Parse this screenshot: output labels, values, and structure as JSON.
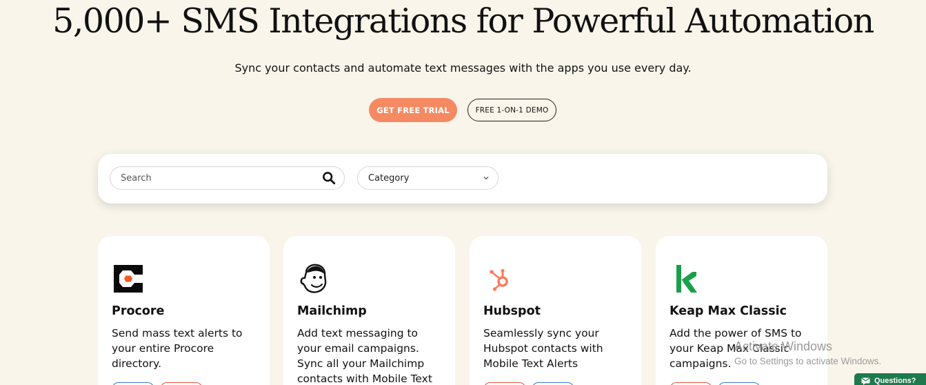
{
  "hero": {
    "title": "5,000+ SMS Integrations for Powerful Automation",
    "subtitle": "Sync your contacts and automate text messages with the apps you use every day."
  },
  "cta": {
    "trial_label": "GET FREE TRIAL",
    "demo_label": "FREE 1-ON-1 DEMO"
  },
  "filters": {
    "search_placeholder": "Search",
    "category_label": "Category"
  },
  "cards": [
    {
      "title": "Procore",
      "description": "Send mass text alerts to your entire Procore directory.",
      "logo": "procore-logo"
    },
    {
      "title": "Mailchimp",
      "description": "Add text messaging to your email campaigns. Sync all your Mailchimp contacts with Mobile Text",
      "logo": "mailchimp-logo"
    },
    {
      "title": "Hubspot",
      "description": "Seamlessly sync your Hubspot contacts with Mobile Text Alerts",
      "logo": "hubspot-logo"
    },
    {
      "title": "Keap Max Classic",
      "description": "Add the power of SMS to your Keap Max Classic campaigns.",
      "logo": "keap-logo"
    }
  ],
  "watermark": {
    "title": "Activate Windows",
    "subtitle": "Go to Settings to activate Windows."
  },
  "chat": {
    "label": "Questions?",
    "icon": "chat-icon"
  },
  "colors": {
    "background": "#f9f5eb",
    "accent": "#f58a62",
    "chat_green": "#1e7a4e",
    "tag_red": "#e5533d",
    "tag_blue": "#3a78c9"
  }
}
